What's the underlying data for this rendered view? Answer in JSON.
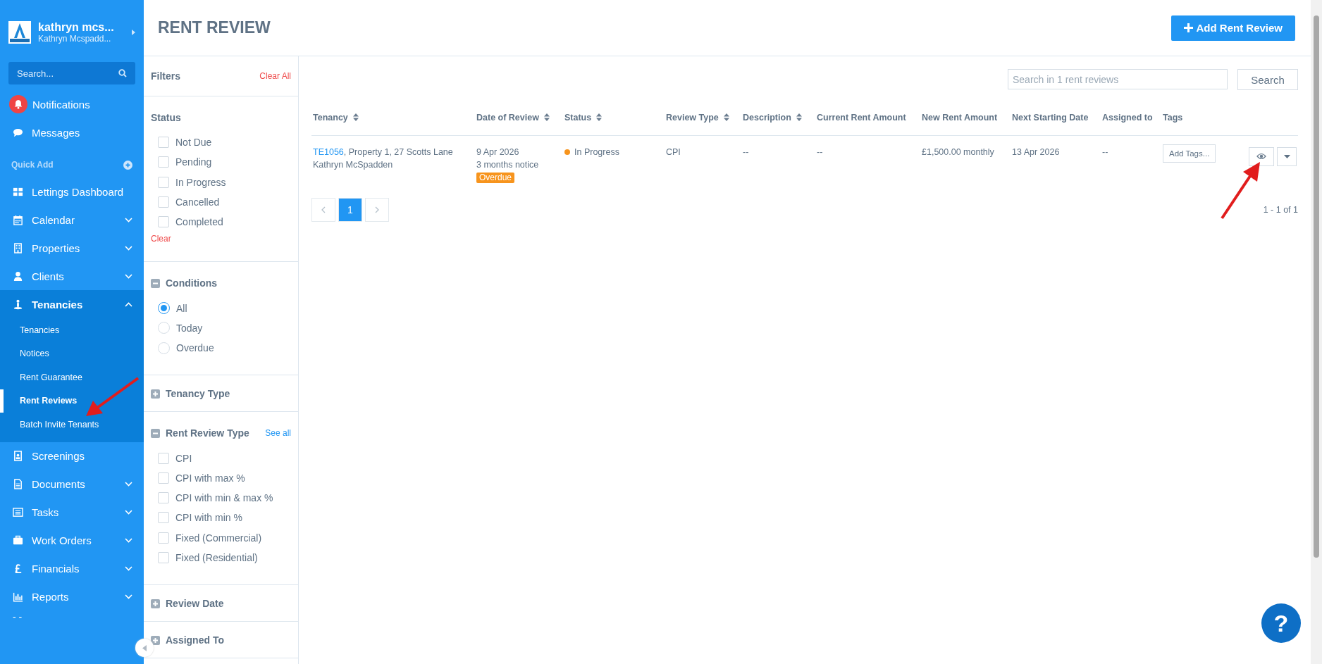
{
  "profile": {
    "name": "kathryn mcs...",
    "subtitle": "Kathryn Mcspadd..."
  },
  "sidebar": {
    "search": {
      "placeholder": "Search..."
    },
    "items": [
      {
        "kind": "alert",
        "label": "Notifications"
      },
      {
        "kind": "nav",
        "label": "Messages"
      },
      {
        "kind": "section",
        "label": "Quick Add"
      },
      {
        "kind": "nav",
        "label": "Lettings Dashboard"
      },
      {
        "kind": "nav",
        "label": "Calendar",
        "expanded": false
      },
      {
        "kind": "nav",
        "label": "Properties",
        "expanded": false
      },
      {
        "kind": "nav",
        "label": "Clients",
        "expanded": false
      },
      {
        "kind": "nav",
        "label": "Tenancies",
        "expanded": true,
        "children": [
          {
            "label": "Tenancies",
            "selected": false
          },
          {
            "label": "Notices",
            "selected": false
          },
          {
            "label": "Rent Guarantee",
            "selected": false
          },
          {
            "label": "Rent Reviews",
            "selected": true
          },
          {
            "label": "Batch Invite Tenants",
            "selected": false
          }
        ]
      },
      {
        "kind": "nav",
        "label": "Screenings"
      },
      {
        "kind": "nav",
        "label": "Documents",
        "expanded": false
      },
      {
        "kind": "nav",
        "label": "Tasks",
        "expanded": false
      },
      {
        "kind": "nav",
        "label": "Work Orders",
        "expanded": false
      },
      {
        "kind": "nav",
        "label": "Financials",
        "expanded": false
      },
      {
        "kind": "nav",
        "label": "Reports",
        "expanded": false
      },
      {
        "kind": "more",
        "label": "- -"
      }
    ]
  },
  "page": {
    "title": "RENT REVIEW",
    "add_button": "Add Rent Review"
  },
  "filters": {
    "title": "Filters",
    "clear_all": "Clear All",
    "sections": [
      {
        "kind": "checkboxes",
        "title": "Status",
        "clear": "Clear",
        "options": [
          {
            "label": "Not Due",
            "checked": false
          },
          {
            "label": "Pending",
            "checked": false
          },
          {
            "label": "In Progress",
            "checked": false
          },
          {
            "label": "Cancelled",
            "checked": false
          },
          {
            "label": "Completed",
            "checked": false
          }
        ]
      },
      {
        "kind": "radios",
        "title": "Conditions",
        "expanded": true,
        "options": [
          {
            "label": "All",
            "selected": true
          },
          {
            "label": "Today",
            "selected": false
          },
          {
            "label": "Overdue",
            "selected": false
          }
        ]
      },
      {
        "title": "Tenancy Type",
        "expanded": false
      },
      {
        "kind": "checkboxes",
        "title": "Rent Review Type",
        "expanded": true,
        "link": "See all",
        "options": [
          {
            "label": "CPI",
            "checked": false
          },
          {
            "label": "CPI with max %",
            "checked": false
          },
          {
            "label": "CPI with min & max %",
            "checked": false
          },
          {
            "label": "CPI with min %",
            "checked": false
          },
          {
            "label": "Fixed (Commercial)",
            "checked": false
          },
          {
            "label": "Fixed (Residential)",
            "checked": false
          }
        ]
      },
      {
        "title": "Review Date",
        "expanded": false
      },
      {
        "title": "Assigned To",
        "expanded": false
      }
    ]
  },
  "search": {
    "placeholder": "Search in 1 rent reviews",
    "button": "Search"
  },
  "table": {
    "columns": [
      {
        "label": "Tenancy",
        "sortable": true
      },
      {
        "label": "Date of Review",
        "sortable": true
      },
      {
        "label": "Status",
        "sortable": true
      },
      {
        "label": "Review Type",
        "sortable": true
      },
      {
        "label": "Description",
        "sortable": true
      },
      {
        "label": "Current Rent Amount",
        "sortable": false
      },
      {
        "label": "New Rent Amount",
        "sortable": false
      },
      {
        "label": "Next Starting Date",
        "sortable": false
      },
      {
        "label": "Assigned to",
        "sortable": false
      },
      {
        "label": "Tags",
        "sortable": false
      }
    ],
    "rows": [
      {
        "tenancy_code": "TE1056",
        "tenancy_address": ", Property 1, 27 Scotts Lane",
        "tenant": "Kathryn McSpadden",
        "date": "9 Apr 2026",
        "notice": "3 months notice",
        "badge": "Overdue",
        "status": {
          "label": "In Progress",
          "color": "#f7941d"
        },
        "review_type": "CPI",
        "description": "--",
        "current_rent": "--",
        "new_rent": "£1,500.00 monthly",
        "next_date": "13 Apr 2026",
        "assigned": "--",
        "tags_button": "Add Tags..."
      }
    ]
  },
  "pagination": {
    "pages": [
      {
        "label": "1",
        "selected": true
      }
    ],
    "range": "1 - 1 of 1"
  },
  "help": {
    "label": "?"
  }
}
